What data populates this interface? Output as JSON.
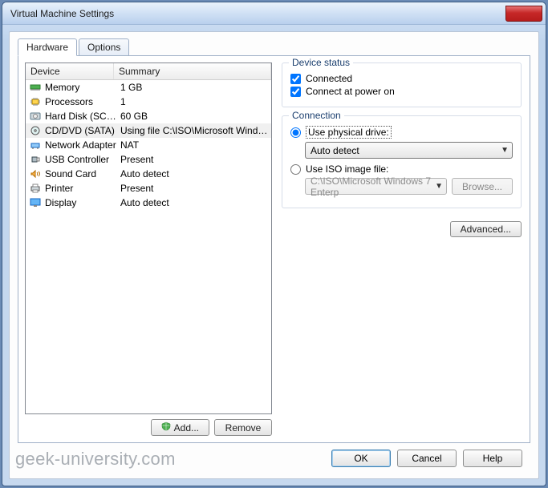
{
  "window": {
    "title": "Virtual Machine Settings"
  },
  "tabs": {
    "hardware": "Hardware",
    "options": "Options"
  },
  "devlist": {
    "header_device": "Device",
    "header_summary": "Summary",
    "rows": [
      {
        "icon": "memory-icon",
        "name": "Memory",
        "summary": "1 GB"
      },
      {
        "icon": "cpu-icon",
        "name": "Processors",
        "summary": "1"
      },
      {
        "icon": "disk-icon",
        "name": "Hard Disk (SCSI)",
        "summary": "60 GB"
      },
      {
        "icon": "disc-icon",
        "name": "CD/DVD (SATA)",
        "summary": "Using file C:\\ISO\\Microsoft Windo..."
      },
      {
        "icon": "net-icon",
        "name": "Network Adapter",
        "summary": "NAT"
      },
      {
        "icon": "usb-icon",
        "name": "USB Controller",
        "summary": "Present"
      },
      {
        "icon": "sound-icon",
        "name": "Sound Card",
        "summary": "Auto detect"
      },
      {
        "icon": "printer-icon",
        "name": "Printer",
        "summary": "Present"
      },
      {
        "icon": "display-icon",
        "name": "Display",
        "summary": "Auto detect"
      }
    ],
    "selected_index": 3,
    "add_label": "Add...",
    "remove_label": "Remove"
  },
  "status_group": {
    "title": "Device status",
    "connected_label": "Connected",
    "connected_checked": true,
    "poweron_label": "Connect at power on",
    "poweron_checked": true
  },
  "connection_group": {
    "title": "Connection",
    "physical_label": "Use physical drive:",
    "physical_selected": true,
    "physical_value": "Auto detect",
    "iso_label": "Use ISO image file:",
    "iso_selected": false,
    "iso_value": "C:\\ISO\\Microsoft Windows 7 Enterp",
    "browse_label": "Browse..."
  },
  "advanced_label": "Advanced...",
  "dialog_buttons": {
    "ok": "OK",
    "cancel": "Cancel",
    "help": "Help"
  },
  "watermark": "geek-university.com"
}
